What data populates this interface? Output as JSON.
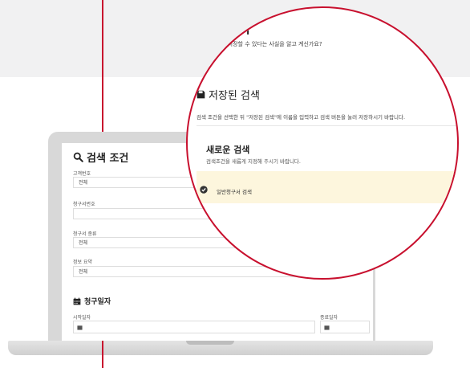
{
  "search_panel": {
    "title": "검색 조건",
    "fields": [
      {
        "label": "고객번호",
        "value": "전체"
      },
      {
        "label": "청구서번호",
        "value": ""
      },
      {
        "label": "청구서 종류",
        "value": "전체"
      },
      {
        "label": "정보 요약",
        "value": "전체"
      }
    ]
  },
  "date_section": {
    "title": "청구일자",
    "start_label": "시작일자",
    "end_label": "종료일자"
  },
  "magnifier": {
    "heading": "구서 검색",
    "subtext": "검색 조건을 저장할 수 있다는 사실을 알고 계신가요?",
    "saved_title": "저장된 검색",
    "saved_desc": "검색 조건을 선택한 뒤 \"저장된 검색\"에 이름을 입력하고 검색 버튼을 눌러 저장하시기 바랍니다.",
    "new_search_title": "새로운 검색",
    "new_search_desc": "검색조건을 새롭게 지정해 주시기 바랍니다.",
    "saved_item": "일반청구서 검색"
  },
  "colors": {
    "accent": "#c8102e",
    "highlight": "#fdf6dd"
  }
}
